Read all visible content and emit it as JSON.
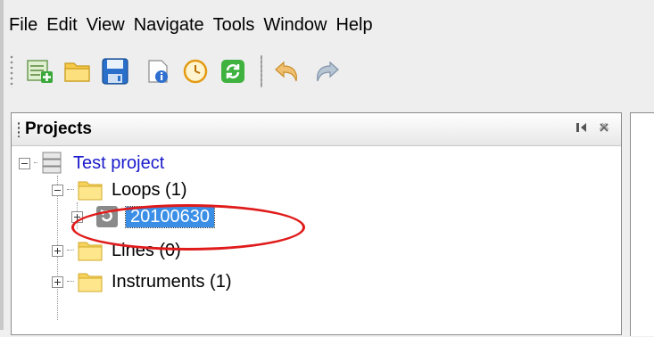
{
  "menubar": {
    "items": [
      "File",
      "Edit",
      "View",
      "Navigate",
      "Tools",
      "Window",
      "Help"
    ]
  },
  "toolbar": {
    "buttons": [
      {
        "icon": "new-project-icon"
      },
      {
        "icon": "open-folder-icon"
      },
      {
        "icon": "save-icon"
      },
      {
        "icon": "properties-icon"
      },
      {
        "icon": "clock-icon"
      },
      {
        "icon": "refresh-icon"
      },
      {
        "icon": "undo-icon"
      },
      {
        "icon": "redo-icon"
      }
    ]
  },
  "projects_panel": {
    "title": "Projects",
    "tree": {
      "project": "Test project",
      "loops": "Loops (1)",
      "loop_item": "20100630",
      "lines": "Lines (0)",
      "instruments": "Instruments (1)"
    }
  },
  "colors": {
    "selection": "#3a8ee6",
    "project_link": "#1a1acc",
    "annotation": "#e01b1b"
  }
}
